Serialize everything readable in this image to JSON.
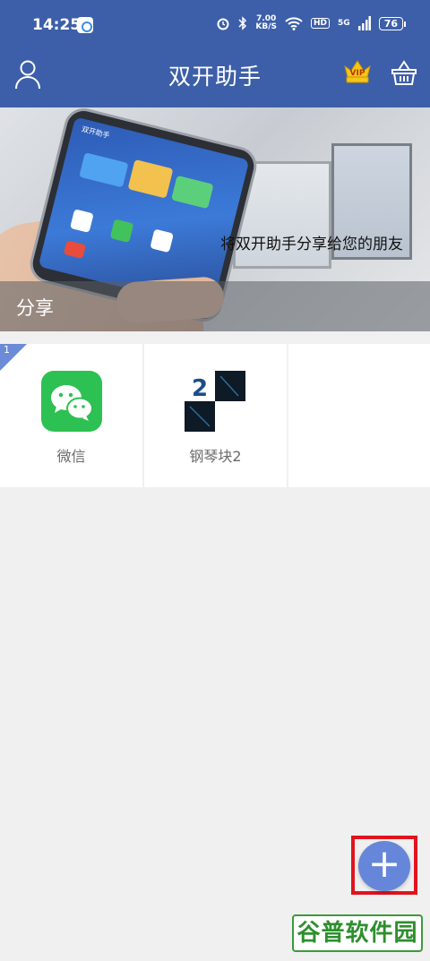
{
  "status_bar": {
    "time": "14:25",
    "network_speed_value": "7.00",
    "network_speed_unit": "KB/S",
    "hd_label": "HD",
    "fiveg_label": "5G",
    "battery": "76"
  },
  "header": {
    "title": "双开助手",
    "vip_label": "VIP"
  },
  "banner": {
    "phone_screen_title": "双开助手",
    "caption": "将双开助手分享给您的朋友",
    "share_label": "分享"
  },
  "apps": {
    "badge": "1",
    "items": [
      {
        "label": "微信",
        "icon": "wechat-icon"
      },
      {
        "label": "钢琴块2",
        "icon": "piano-tiles-icon",
        "icon_text": "2"
      }
    ]
  },
  "fab": {
    "symbol": "+"
  },
  "watermark": {
    "text": "谷普软件园"
  },
  "colors": {
    "primary": "#3d5fa9",
    "fab": "#6686d9",
    "highlight_frame": "#e0141e",
    "wechat": "#2dc052"
  }
}
